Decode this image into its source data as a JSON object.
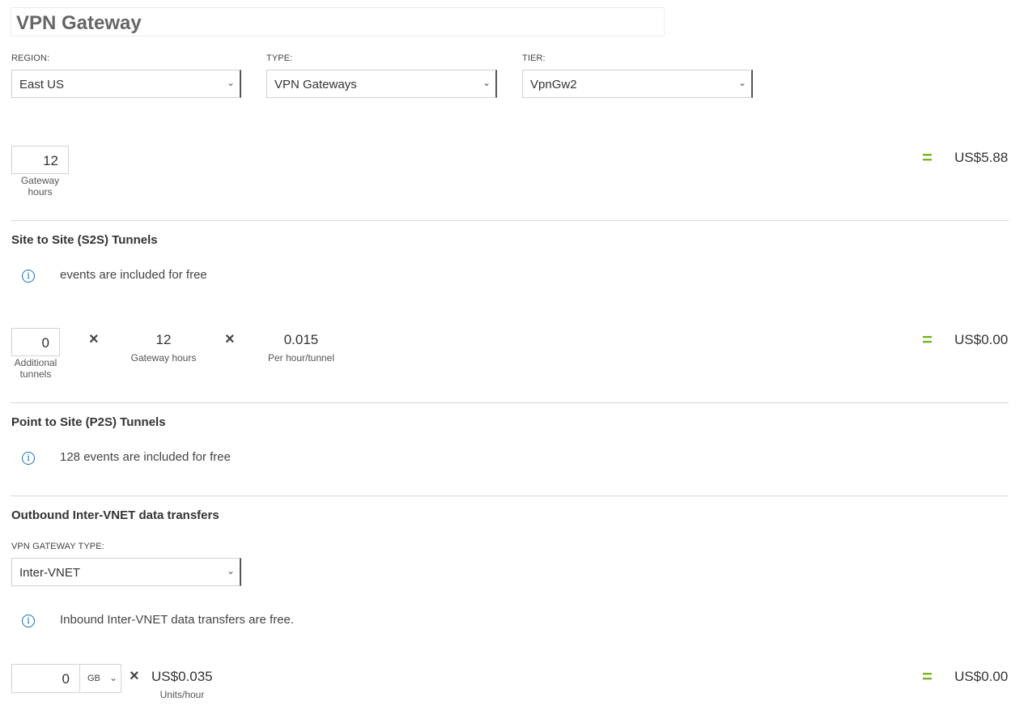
{
  "title": "VPN Gateway",
  "region": {
    "label": "REGION:",
    "value": "East US"
  },
  "type": {
    "label": "TYPE:",
    "value": "VPN Gateways"
  },
  "tier": {
    "label": "TIER:",
    "value": "VpnGw2"
  },
  "gateway": {
    "hours_value": "12",
    "hours_label_line1": "Gateway",
    "hours_label_line2": "hours",
    "equals": "=",
    "total": "US$5.88"
  },
  "s2s": {
    "title": "Site to Site (S2S) Tunnels",
    "info": "events are included for free",
    "tunnels_value": "0",
    "tunnels_label_line1": "Additional",
    "tunnels_label_line2": "tunnels",
    "times": "×",
    "hours_value": "12",
    "hours_label": "Gateway hours",
    "rate_value": "0.015",
    "rate_label": "Per hour/tunnel",
    "equals": "=",
    "total": "US$0.00"
  },
  "p2s": {
    "title": "Point to Site (P2S) Tunnels",
    "info": "128 events are included for free"
  },
  "outbound": {
    "title": "Outbound Inter-VNET data transfers",
    "type_label": "VPN GATEWAY TYPE:",
    "type_value": "Inter-VNET",
    "info": "Inbound Inter-VNET data transfers are free.",
    "amount_value": "0",
    "unit_value": "GB",
    "times": "×",
    "rate_value": "US$0.035",
    "rate_label": "Units/hour",
    "equals": "=",
    "total": "US$0.00"
  },
  "icons": {
    "info": "info-icon",
    "chevron": "chevron-down-icon",
    "times": "times-icon"
  },
  "colors": {
    "accent": "#7ab31f",
    "info": "#1a6fb5"
  }
}
